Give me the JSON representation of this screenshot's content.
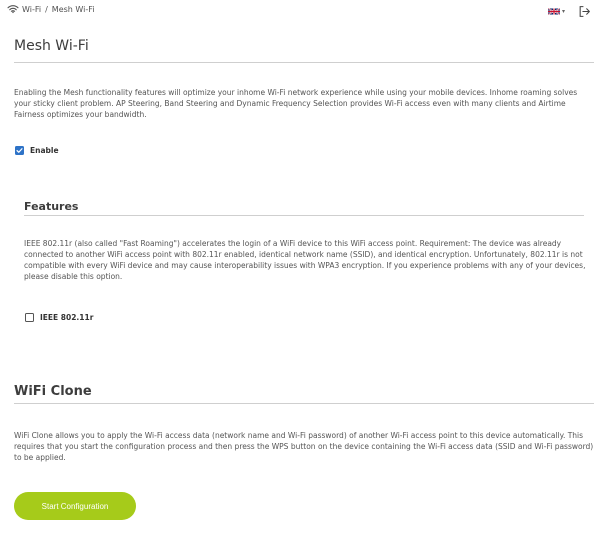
{
  "breadcrumb": {
    "icon": "wifi-icon",
    "section": "Wi-Fi",
    "separator": "/",
    "page": "Mesh Wi-Fi"
  },
  "header": {
    "language_icon": "uk-flag-icon",
    "logout_icon": "logout-icon"
  },
  "mesh": {
    "title": "Mesh Wi-Fi",
    "description": "Enabling the Mesh functionality features will optimize your inhome Wi-Fi network experience while using your mobile devices. Inhome roaming solves your sticky client problem. AP Steering, Band Steering and Dynamic Frequency Selection provides Wi-Fi access even with many clients and Airtime Fairness optimizes your bandwidth.",
    "enable_label": "Enable",
    "enable_checked": true
  },
  "features": {
    "title": "Features",
    "description": "IEEE 802.11r (also called \"Fast Roaming\") accelerates the login of a WiFi device to this WiFi access point. Requirement: The device was already connected to another WiFi access point with 802.11r enabled, identical network name (SSID), and identical encryption. Unfortunately, 802.11r is not compatible with every WiFi device and may cause interoperability issues with WPA3 encryption. If you experience problems with any of your devices, please disable this option.",
    "ieee_label": "IEEE 802.11r",
    "ieee_checked": false
  },
  "clone": {
    "title": "WiFi Clone",
    "description": "WiFi Clone allows you to apply the Wi-Fi access data (network name and Wi-Fi password) of another Wi-Fi access point to this device automatically. This requires that you start the configuration process and then press the WPS button on the device containing the Wi-Fi access data (SSID and Wi-Fi password) to be applied.",
    "button_label": "Start Configuration"
  },
  "colors": {
    "accent_blue": "#2e73c7",
    "button_green": "#a6cb1a"
  }
}
